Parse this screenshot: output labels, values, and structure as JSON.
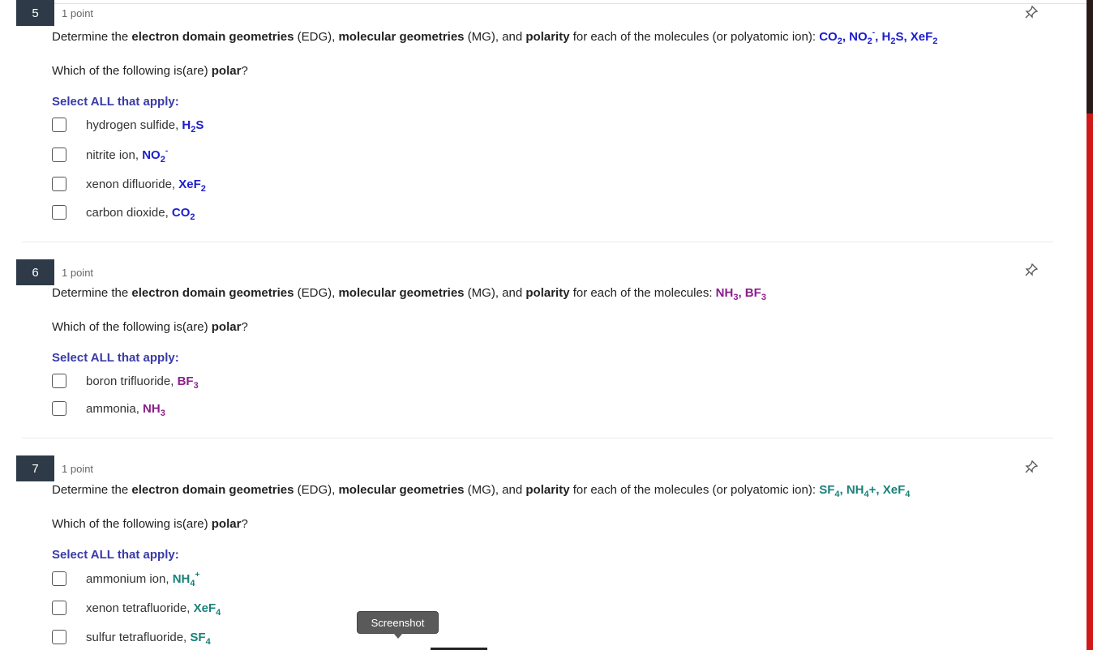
{
  "questions": [
    {
      "number": "5",
      "points": "1 point",
      "intro": "Determine the ",
      "edg": "electron domain geometries",
      "edg_abbr": " (EDG), ",
      "mg": "molecular geometries",
      "mg_abbr": " (MG), and ",
      "polarity": "polarity",
      "rest": " for each of the molecules (or polyatomic ion): ",
      "prompt_pre": "Which of the following is(are) ",
      "prompt_bold": "polar",
      "prompt_post": "?",
      "select_all": "Select ALL that apply:",
      "options": [
        {
          "name": "hydrogen sulfide, ",
          "formula": "H2S"
        },
        {
          "name": "nitrite ion, ",
          "formula": "NO2-"
        },
        {
          "name": "xenon difluoride, ",
          "formula": "XeF2"
        },
        {
          "name": "carbon dioxide, ",
          "formula": "CO2"
        }
      ]
    },
    {
      "number": "6",
      "points": "1 point",
      "intro": "Determine the ",
      "edg": "electron domain geometries",
      "edg_abbr": " (EDG), ",
      "mg": "molecular geometries",
      "mg_abbr": " (MG), and ",
      "polarity": "polarity",
      "rest": " for each of the molecules: ",
      "prompt_pre": "Which of the following is(are) ",
      "prompt_bold": "polar",
      "prompt_post": "?",
      "select_all": "Select ALL that apply:",
      "options": [
        {
          "name": "boron trifluoride, ",
          "formula": "BF3"
        },
        {
          "name": "ammonia, ",
          "formula": "NH3"
        }
      ]
    },
    {
      "number": "7",
      "points": "1 point",
      "intro": "Determine the ",
      "edg": "electron domain geometries",
      "edg_abbr": " (EDG), ",
      "mg": "molecular geometries",
      "mg_abbr": " (MG), and ",
      "polarity": "polarity",
      "rest": " for each of the molecules (or polyatomic ion): ",
      "prompt_pre": "Which of the following is(are) ",
      "prompt_bold": "polar",
      "prompt_post": "?",
      "select_all": "Select ALL that apply:",
      "options": [
        {
          "name": "ammonium ion, ",
          "formula": "NH4+"
        },
        {
          "name": "xenon tetrafluoride, ",
          "formula": "XeF4"
        },
        {
          "name": "sulfur tetrafluoride, ",
          "formula": "SF4"
        }
      ]
    }
  ],
  "tooltip": "Screenshot",
  "colors": {
    "blue": "#1c1ccf",
    "purple": "#8a1e8a",
    "teal": "#17827a",
    "qnum_bg": "#2e3a47"
  }
}
